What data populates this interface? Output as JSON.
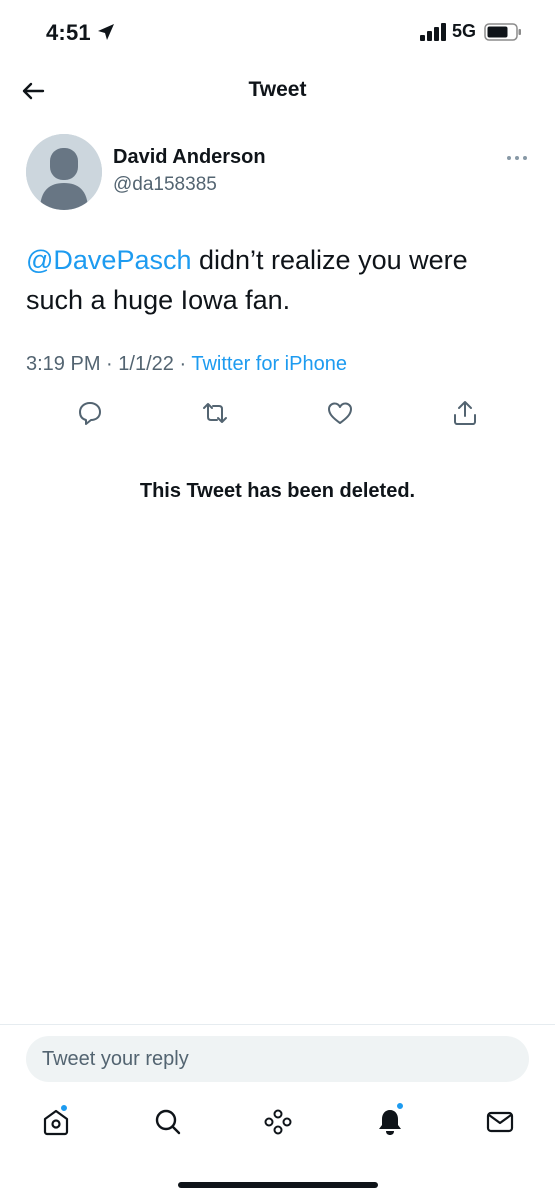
{
  "status_bar": {
    "time": "4:51",
    "network": "5G",
    "icons": [
      "location-arrow-icon",
      "signal-bars-icon",
      "battery-icon"
    ]
  },
  "header": {
    "title": "Tweet",
    "back_icon": "arrow-left-icon"
  },
  "tweet": {
    "author_name": "David Anderson",
    "author_handle": "@da158385",
    "mention": "@DavePasch",
    "text": " didn’t realize you were such a huge Iowa fan.",
    "time": "3:19 PM",
    "date": "1/1/22",
    "separator": "·",
    "source": "Twitter for iPhone",
    "actions": [
      "reply-icon",
      "retweet-icon",
      "like-icon",
      "share-icon"
    ]
  },
  "notice": {
    "deleted": "This Tweet has been deleted."
  },
  "reply": {
    "placeholder": "Tweet your reply"
  },
  "tab_bar": {
    "tabs": [
      "home-icon",
      "search-icon",
      "spaces-icon",
      "notifications-icon",
      "messages-icon"
    ]
  },
  "colors": {
    "accent": "#1d9bf0",
    "text": "#0f1419",
    "secondary_text": "#536471",
    "input_background": "#eff3f4"
  }
}
